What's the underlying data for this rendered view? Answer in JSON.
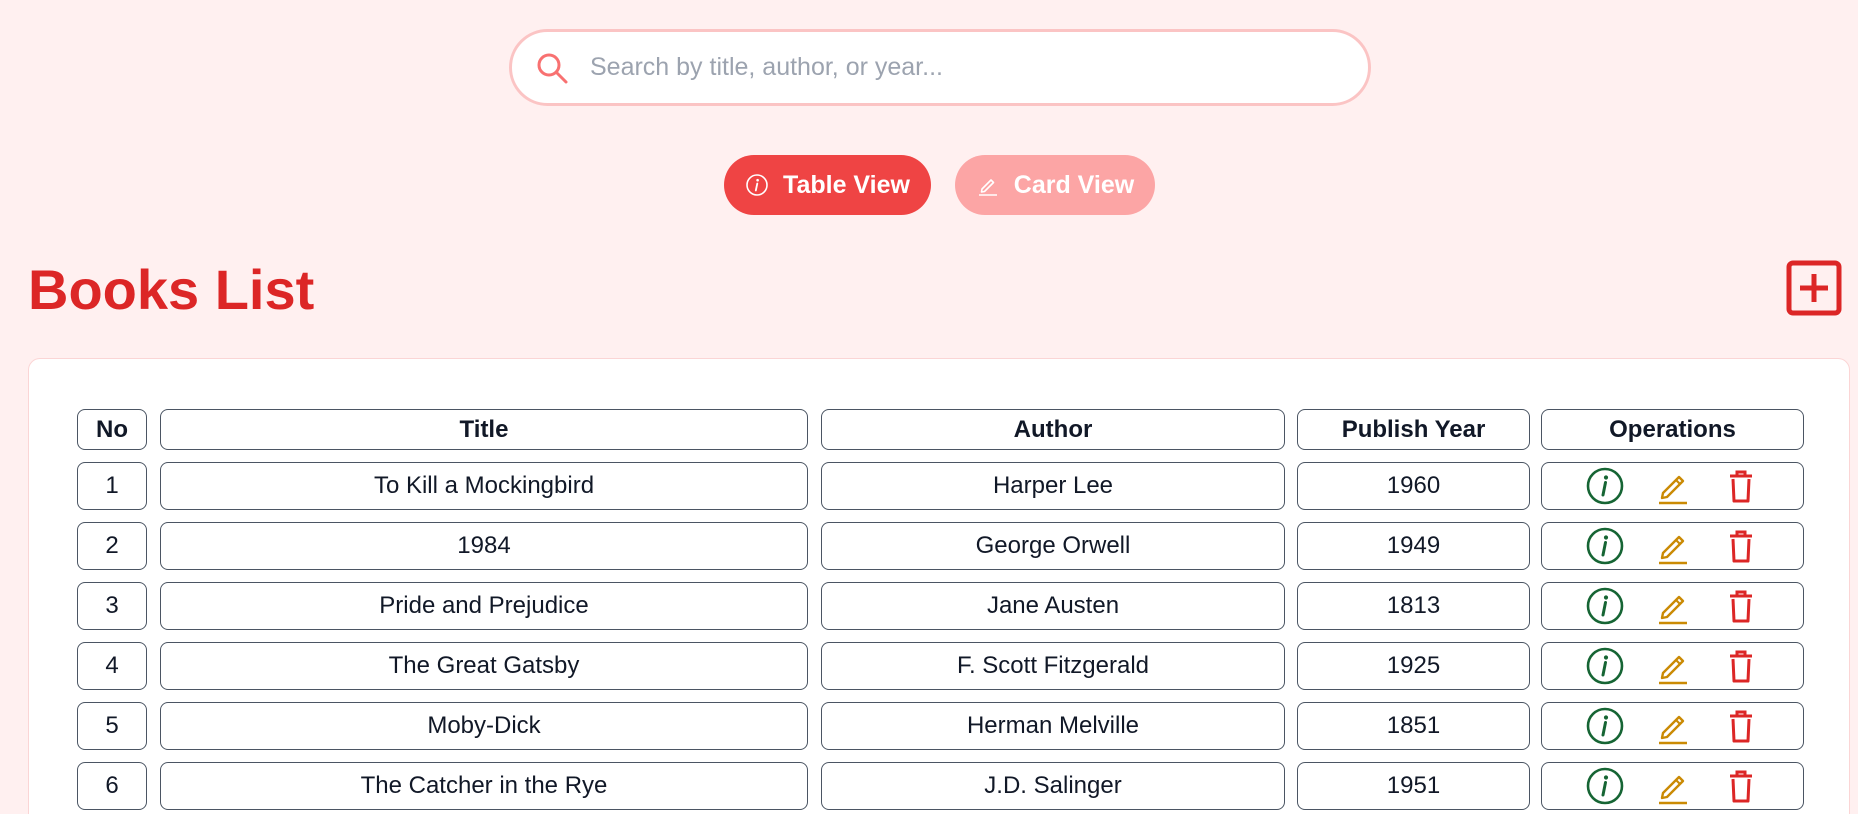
{
  "search": {
    "placeholder": "Search by title, author, or year...",
    "value": ""
  },
  "view_toggle": {
    "table_label": "Table View",
    "card_label": "Card View",
    "table_icon": "info-icon",
    "card_icon": "pencil-icon"
  },
  "page": {
    "title": "Books List",
    "add_icon": "plus-box-icon"
  },
  "colors": {
    "background": "#fff0f0",
    "accent": "#ef4444",
    "accent_light": "#fca5a5",
    "title": "#dc2626",
    "info": "#166534",
    "edit": "#ca8a04",
    "delete": "#dc2626"
  },
  "table": {
    "headers": [
      "No",
      "Title",
      "Author",
      "Publish Year",
      "Operations"
    ],
    "rows": [
      {
        "no": "1",
        "title": "To Kill a Mockingbird",
        "author": "Harper Lee",
        "year": "1960"
      },
      {
        "no": "2",
        "title": "1984",
        "author": "George Orwell",
        "year": "1949"
      },
      {
        "no": "3",
        "title": "Pride and Prejudice",
        "author": "Jane Austen",
        "year": "1813"
      },
      {
        "no": "4",
        "title": "The Great Gatsby",
        "author": "F. Scott Fitzgerald",
        "year": "1925"
      },
      {
        "no": "5",
        "title": "Moby-Dick",
        "author": "Herman Melville",
        "year": "1851"
      },
      {
        "no": "6",
        "title": "The Catcher in the Rye",
        "author": "J.D. Salinger",
        "year": "1951"
      }
    ],
    "operation_icons": [
      "info-circle-icon",
      "pencil-edit-icon",
      "trash-icon"
    ]
  }
}
